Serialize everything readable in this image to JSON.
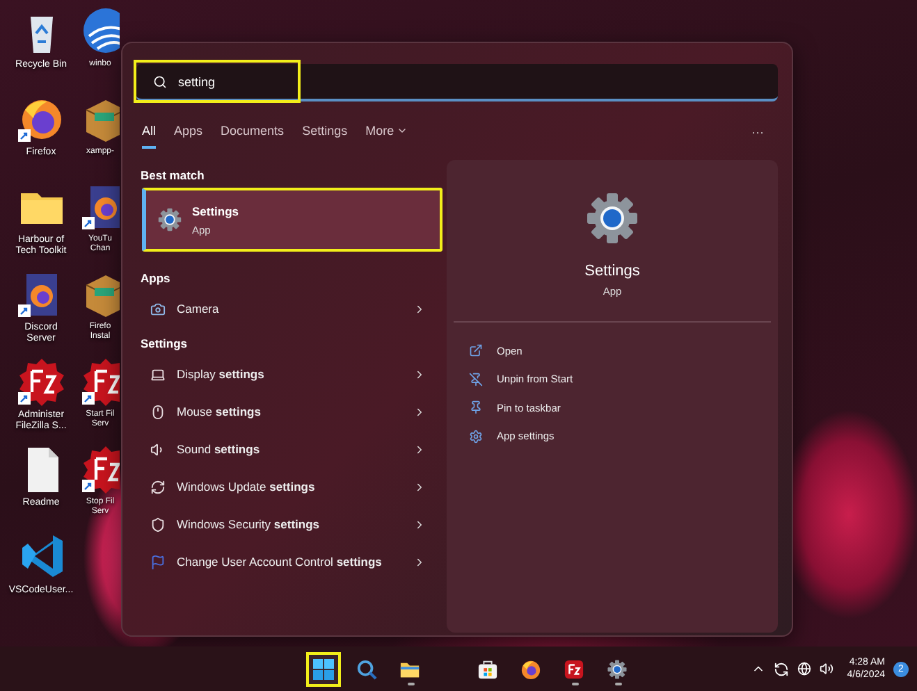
{
  "desktop": {
    "column_1": [
      {
        "label": "Recycle Bin",
        "kind": "recycle",
        "shortcut": false
      },
      {
        "label": "Firefox",
        "kind": "browser",
        "shortcut": true
      },
      {
        "label": "Harbour of\nTech Toolkit",
        "kind": "folder",
        "shortcut": false
      },
      {
        "label": "Discord\nServer",
        "kind": "browser-file",
        "shortcut": true
      },
      {
        "label": "Administer\nFileZilla S...",
        "kind": "ftp",
        "shortcut": true
      },
      {
        "label": "Readme",
        "kind": "document",
        "shortcut": false
      },
      {
        "label": "VSCodeUser...",
        "kind": "code",
        "shortcut": false
      }
    ],
    "column_2": [
      {
        "label": "winbo",
        "kind": "globe",
        "shortcut": false
      },
      {
        "label": "xampp-",
        "kind": "package",
        "shortcut": false
      },
      {
        "label": "YouTu\nChan",
        "kind": "browser-file",
        "shortcut": true
      },
      {
        "label": "Firefo\nInstal",
        "kind": "package",
        "shortcut": false
      },
      {
        "label": "Start Fil\nServ",
        "kind": "ftp",
        "shortcut": true
      },
      {
        "label": "Stop Fil\nServ",
        "kind": "ftp",
        "shortcut": true
      }
    ]
  },
  "search": {
    "value": "setting",
    "highlighted": true
  },
  "filters": [
    {
      "label": "All",
      "selected": true,
      "caret": false
    },
    {
      "label": "Apps",
      "selected": false,
      "caret": false
    },
    {
      "label": "Documents",
      "selected": false,
      "caret": false
    },
    {
      "label": "Settings",
      "selected": false,
      "caret": false
    },
    {
      "label": "More",
      "selected": false,
      "caret": true
    }
  ],
  "more_options": "···",
  "best_match": {
    "heading": "Best match",
    "title": "Settings",
    "subtitle": "App",
    "selected": true,
    "highlighted": true
  },
  "sections": [
    {
      "heading": "Apps",
      "items": [
        {
          "label": "Camera",
          "kind": "camera"
        }
      ]
    },
    {
      "heading": "Settings",
      "items": [
        {
          "label": "Display **settings**",
          "kind": "display"
        },
        {
          "label": "Mouse **settings**",
          "kind": "mouse"
        },
        {
          "label": "Sound **settings**",
          "kind": "sound"
        },
        {
          "label": "Windows Update **settings**",
          "kind": "update"
        },
        {
          "label": "Windows Security **settings**",
          "kind": "security"
        },
        {
          "label": "Change User Account Control **settings**",
          "kind": "flag"
        }
      ]
    }
  ],
  "preview": {
    "title": "Settings",
    "subtitle": "App",
    "actions": [
      {
        "label": "Open",
        "kind": "open"
      },
      {
        "label": "Unpin from Start",
        "kind": "unpin"
      },
      {
        "label": "Pin to taskbar",
        "kind": "pin"
      },
      {
        "label": "App settings",
        "kind": "gear"
      }
    ]
  },
  "taskbar": {
    "apps": [
      {
        "kind": "start",
        "running": false,
        "highlighted": true
      },
      {
        "kind": "search",
        "running": false,
        "highlighted": false
      },
      {
        "kind": "explorer",
        "running": true,
        "highlighted": false
      },
      {
        "kind": "store",
        "running": false,
        "highlighted": false
      },
      {
        "kind": "browser",
        "running": false,
        "highlighted": false
      },
      {
        "kind": "ftp",
        "running": true,
        "highlighted": false
      },
      {
        "kind": "settings",
        "running": true,
        "highlighted": false
      }
    ],
    "time": "4:28 AM",
    "date": "4/6/2024",
    "notifications": "2"
  }
}
